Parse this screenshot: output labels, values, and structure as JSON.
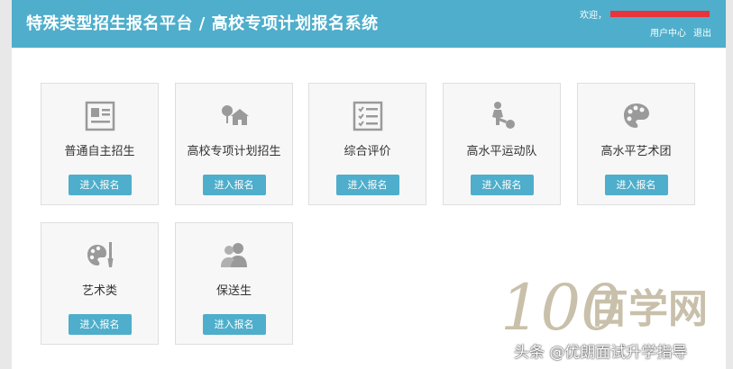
{
  "header": {
    "title": "特殊类型招生报名平台 / 高校专项计划报名系统",
    "welcome_prefix": "欢迎，",
    "user_center": "用户中心",
    "logout": "退出"
  },
  "cards": [
    {
      "label": "普通自主招生",
      "button": "进入报名",
      "icon": "profile-card-icon"
    },
    {
      "label": "高校专项计划招生",
      "button": "进入报名",
      "icon": "house-tree-icon"
    },
    {
      "label": "综合评价",
      "button": "进入报名",
      "icon": "checklist-icon"
    },
    {
      "label": "高水平运动队",
      "button": "进入报名",
      "icon": "soccer-player-icon"
    },
    {
      "label": "高水平艺术团",
      "button": "进入报名",
      "icon": "palette-icon"
    },
    {
      "label": "艺术类",
      "button": "进入报名",
      "icon": "palette-brush-icon"
    },
    {
      "label": "保送生",
      "button": "进入报名",
      "icon": "users-icon"
    }
  ],
  "watermark": {
    "logo_text": "100百学网",
    "caption": "头条 @优朗面试升学指导"
  },
  "colors": {
    "header_bg": "#4eaecb",
    "button_bg": "#4eaecb",
    "icon_gray": "#9a9a9a"
  }
}
